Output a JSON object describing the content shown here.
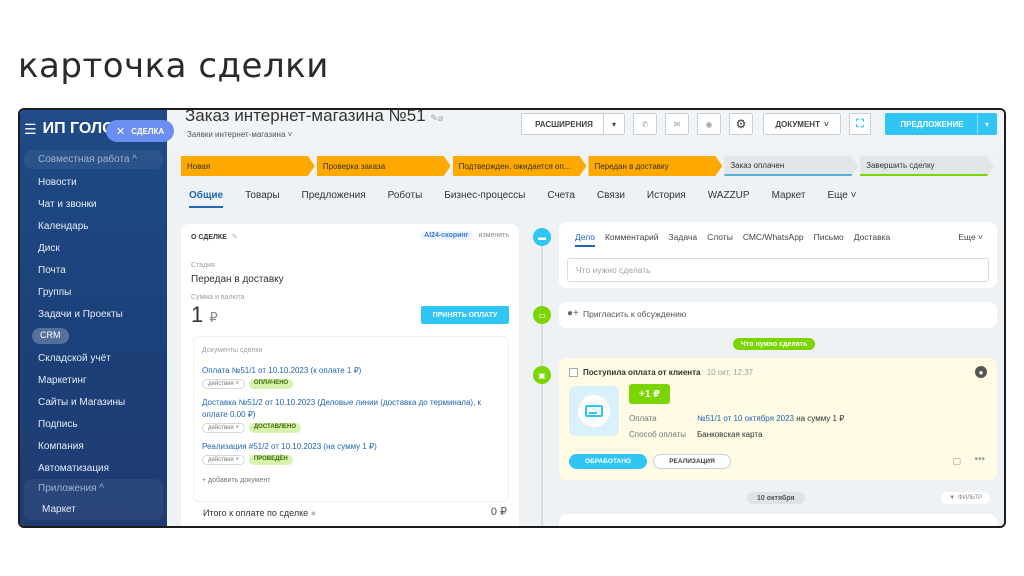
{
  "slide": {
    "title": "карточка сделки"
  },
  "sidebar": {
    "brand": "ИП ГОЛО",
    "deal_tag": "СДЕЛКА",
    "section_work": "Совместная работа ^",
    "items_work": [
      "Новости",
      "Чат и звонки",
      "Календарь",
      "Диск",
      "Почта",
      "Группы",
      "Задачи и Проекты"
    ],
    "crm": "CRM",
    "items_crm": [
      "Складской учёт",
      "Маркетинг",
      "Сайты и Магазины",
      "Подпись",
      "Компания",
      "Автоматизация"
    ],
    "section_apps": "Приложения ^",
    "items_apps": [
      "Маркет"
    ]
  },
  "header": {
    "title": "Заказ интернет-магазина №51",
    "subtitle": "Заявки интернет-магазина ˅",
    "btn_extensions": "РАСШИРЕНИЯ",
    "btn_document": "ДОКУМЕНТ",
    "btn_offer": "ПРЕДЛОЖЕНИЕ"
  },
  "stages": [
    {
      "label": "Новая",
      "state": "done"
    },
    {
      "label": "Проверка заказа",
      "state": "done"
    },
    {
      "label": "Подтвержден, ожидается оп...",
      "state": "done"
    },
    {
      "label": "Передан в доставку",
      "state": "done"
    },
    {
      "label": "Заказ оплачен",
      "state": "todo"
    },
    {
      "label": "Завершить сделку",
      "state": "todo"
    }
  ],
  "tabs": [
    "Общие",
    "Товары",
    "Предложения",
    "Роботы",
    "Бизнес-процессы",
    "Счета",
    "Связи",
    "История",
    "WAZZUP",
    "Маркет",
    "Еще ˅"
  ],
  "about": {
    "heading": "О СДЕЛКЕ",
    "ai_label": "AI24-скоринг",
    "change": "изменить",
    "stage_label": "Стадия",
    "stage_value": "Передан в доставку",
    "sum_label": "Сумма и валюта",
    "sum_value": "1",
    "currency": "₽",
    "accept_payment": "ПРИНЯТЬ ОПЛАТУ",
    "docs_label": "Документы сделки",
    "docs": [
      {
        "text": "Оплата №51/1 от 10.10.2023 (к оплате 1 ₽)",
        "actions": "действия ˅",
        "status": "ОПЛАЧЕНО"
      },
      {
        "text": "Доставка №51/2 от 10.10.2023 (Деловые линии (доставка до терминала), к оплате 0.00 ₽)",
        "actions": "действия ˅",
        "status": "ДОСТАВЛЕНО"
      },
      {
        "text": "Реализация #51/2 от 10.10.2023 (на сумму 1 ₽)",
        "actions": "действия ˅",
        "status": "ПРОВЕДЁН"
      }
    ],
    "add_doc": "+ добавить документ",
    "total_label": "Итого к оплате по сделке",
    "total_value": "0 ₽"
  },
  "activity": {
    "tabs": [
      "Дело",
      "Комментарий",
      "Задача",
      "Слоты",
      "СМС/WhatsApp",
      "Письмо",
      "Доставка"
    ],
    "more": "Еще ˅",
    "input_placeholder": "Что нужно сделать",
    "invite": "Пригласить к обсуждению",
    "todo_pill": "Что нужно сделать",
    "payment_title": "Поступила оплата от клиента",
    "payment_time": "10 окт, 12:37",
    "amount": "+1 ₽",
    "pay_label": "Оплата",
    "pay_link": "№51/1 от 10 октября 2023",
    "pay_suffix": "на сумму 1 ₽",
    "method_label": "Способ оплаты",
    "method_value": "Банковская карта",
    "btn_processed": "ОБРАБОТАНО",
    "btn_realization": "РЕАЛИЗАЦИЯ",
    "date_pill": "10 октября",
    "filter": "ФИЛЬТР"
  },
  "colors": {
    "accent": "#2fc6f6",
    "stage_done": "#ffa900",
    "success": "#7bd500",
    "sidebar": "#1f4b86"
  }
}
